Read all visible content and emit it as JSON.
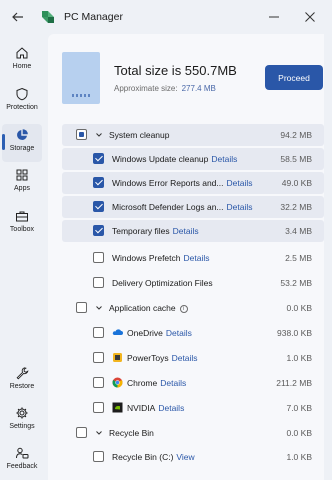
{
  "window": {
    "title": "PC Manager"
  },
  "sidebar": {
    "items": [
      {
        "label": "Home"
      },
      {
        "label": "Protection"
      },
      {
        "label": "Storage"
      },
      {
        "label": "Apps"
      },
      {
        "label": "Toolbox"
      },
      {
        "label": "Restore"
      },
      {
        "label": "Settings"
      },
      {
        "label": "Feedback"
      }
    ],
    "active": "Storage"
  },
  "summary": {
    "total": "Total size is 550.7MB",
    "approx_label": "Approximate size:",
    "approx_value": "277.4 MB",
    "proceed_label": "Proceed"
  },
  "groups": [
    {
      "label": "System cleanup",
      "size": "94.2 MB",
      "state": "partial",
      "items": [
        {
          "label": "Windows Update cleanup",
          "details": "Details",
          "size": "58.5 MB",
          "checked": true
        },
        {
          "label": "Windows Error Reports and...",
          "details": "Details",
          "size": "49.0 KB",
          "checked": true
        },
        {
          "label": "Microsoft Defender Logs an...",
          "details": "Details",
          "size": "32.2 MB",
          "checked": true
        },
        {
          "label": "Temporary files",
          "details": "Details",
          "size": "3.4 MB",
          "checked": true
        },
        {
          "label": "Windows Prefetch",
          "details": "Details",
          "size": "2.5 MB",
          "checked": false
        },
        {
          "label": "Delivery Optimization Files",
          "details": "",
          "size": "53.2 MB",
          "checked": false
        }
      ]
    },
    {
      "label": "Application cache",
      "info": "i",
      "size": "0.0 KB",
      "state": "unchecked",
      "items": [
        {
          "label": "OneDrive",
          "details": "Details",
          "size": "938.0 KB",
          "checked": false,
          "icon": "onedrive-icon"
        },
        {
          "label": "PowerToys",
          "details": "Details",
          "size": "1.0 KB",
          "checked": false,
          "icon": "powertoys-icon"
        },
        {
          "label": "Chrome",
          "details": "Details",
          "size": "211.2 MB",
          "checked": false,
          "icon": "chrome-icon"
        },
        {
          "label": "NVIDIA",
          "details": "Details",
          "size": "7.0 KB",
          "checked": false,
          "icon": "nvidia-icon"
        }
      ]
    },
    {
      "label": "Recycle Bin",
      "size": "0.0 KB",
      "state": "unchecked",
      "items": [
        {
          "label": "Recycle Bin (C:)",
          "details": "View",
          "size": "1.0 KB",
          "checked": false
        }
      ]
    }
  ],
  "colors": {
    "accent": "#2a57a8",
    "selected_row": "#e6e9f1",
    "drive": "#b7d0ef"
  }
}
